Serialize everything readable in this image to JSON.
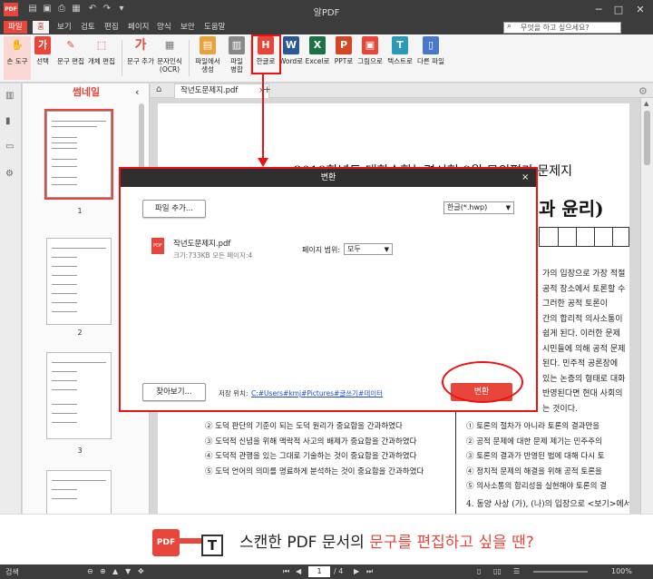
{
  "app": {
    "title": "알PDF",
    "logo": "PDF",
    "window_controls": [
      "─",
      "□",
      "✕"
    ]
  },
  "menus": [
    "파일",
    "홈",
    "보기",
    "검토",
    "편집",
    "페이지",
    "양식",
    "보안",
    "도움말"
  ],
  "active_menu": "홈",
  "search": {
    "placeholder": "무엇을 하고 싶으세요?"
  },
  "ribbon": {
    "tools": [
      {
        "label": "손 도구",
        "icon": "hand-icon",
        "color": "#e8463b"
      },
      {
        "label": "선택",
        "icon": "select-text-icon",
        "color": "#e8463b"
      },
      {
        "label": "문구 편집",
        "icon": "edit-text-icon",
        "color": "#e8463b"
      },
      {
        "label": "개체 편집",
        "icon": "edit-object-icon",
        "color": "#e8463b"
      },
      {
        "label": "문구 추가",
        "icon": "add-text-icon",
        "color": "#e8463b"
      },
      {
        "label": "문자인식\n(OCR)",
        "icon": "ocr-icon",
        "color": "#777"
      },
      {
        "label": "파일에서\n생성",
        "icon": "create-from-file-icon",
        "color": "#e8a23b"
      },
      {
        "label": "파일\n병합",
        "icon": "merge-icon",
        "color": "#777"
      },
      {
        "label": "한글로",
        "icon": "hwp-icon",
        "color": "#e8463b"
      },
      {
        "label": "Word로",
        "icon": "word-icon",
        "color": "#2b5797"
      },
      {
        "label": "Excel로",
        "icon": "excel-icon",
        "color": "#1e7145"
      },
      {
        "label": "PPT로",
        "icon": "ppt-icon",
        "color": "#d24726"
      },
      {
        "label": "그림으로",
        "icon": "image-icon",
        "color": "#e8463b"
      },
      {
        "label": "텍스트로",
        "icon": "text-icon",
        "color": "#2b9ab8"
      },
      {
        "label": "다른 파일",
        "icon": "other-file-icon",
        "color": "#4a78c8"
      }
    ],
    "tool_glyphs": [
      "✋",
      "가",
      "✎",
      "⬚",
      "가",
      "▦",
      "▤",
      "▥",
      "H",
      "W",
      "X",
      "P",
      "▣",
      "T",
      "▯"
    ]
  },
  "thumbnails": {
    "header": "썸네일",
    "pages": [
      "1",
      "2",
      "3"
    ]
  },
  "document": {
    "tab": "작년도문제지.pdf",
    "lines_top": [
      "2019학년도 대학수학능력시험 9월 모의평가 문제지",
      "과 윤리)"
    ],
    "right_col": [
      "가의 입장으로 가장 적절",
      "공적 장소에서 토론할 수",
      "그러한 공적 토론이",
      "간의 합리적 의사소통이",
      "쉽게 된다. 이러한 문제",
      "시민들에 의해 공적 문제",
      "된다. 민주적 공론장에",
      "있는 논증의 형태로 대화",
      "반영된다면 현대 사회의",
      "는 것이다."
    ],
    "options_left": [
      "② 도덕 판단의 기준이 되는 도덕 원리가 중요함을 간과하였다",
      "③ 도덕적 신념을 위해 맥락적 사고의 배제가 중요함을 간과하였다",
      "④ 도덕적 관행을 있는 그대로 기술하는 것이 중요함을 간과하였다",
      "⑤ 도덕 언어의 의미를 명료하게 분석하는 것이 중요함을 간과하였다"
    ],
    "options_right": [
      "① 토론의 절차가 아니라 토론의 결과만을",
      "② 공적 문제에 대한 문제 제기는 민주주의",
      "③ 토론의 결과가 반영된 법에 대해 다시 토",
      "④ 정치적 문제의 해결을 위해 공적 토론을",
      "⑤ 의사소통의 합리성을 실현해야 토론의 결"
    ],
    "question4": "4.  동양 사상 (가), (나)의 입장으로 <보기>에서"
  },
  "dialog": {
    "title": "변환",
    "add_file": "파일 추가...",
    "format": "한글(*.hwp)",
    "file_name": "작년도문제지.pdf",
    "file_meta": "크기:733KB  모든 페이지:4",
    "page_range_label": "페이지 범위:",
    "page_range": "모두",
    "browse": "찾아보기...",
    "save_label": "저장 위치:",
    "save_path": "C:#Users#kmj#Pictures#글쓰기#데이터",
    "convert": "변환"
  },
  "banner": {
    "text_a": "스캔한 PDF 문서의 ",
    "text_b": "문구를 편집하고 싶을 땐?",
    "pdf": "PDF",
    "t": "T"
  },
  "status": {
    "left": "검색",
    "page": "1",
    "total": "/ 4",
    "zoom": "100%"
  },
  "colors": {
    "accent": "#e8463b",
    "annotation": "#ee1111"
  }
}
